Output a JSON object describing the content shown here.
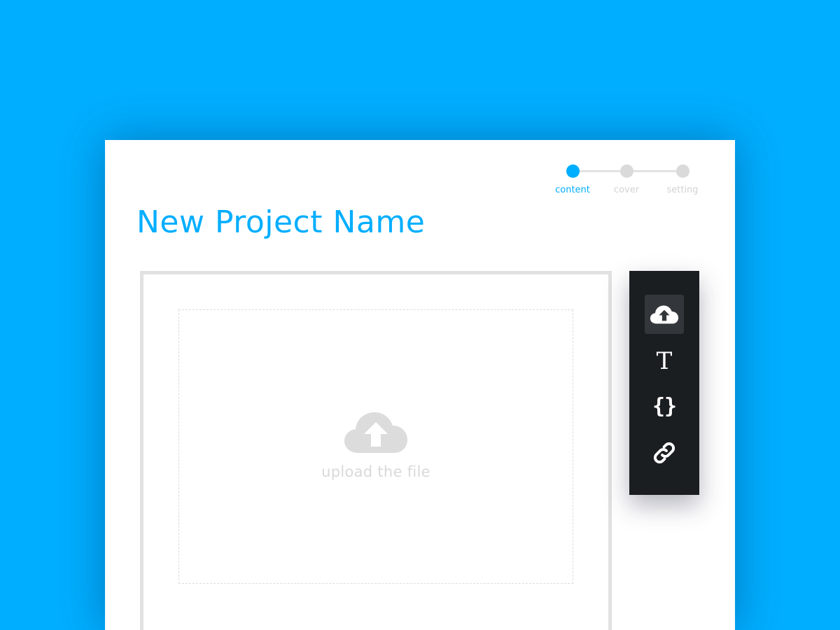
{
  "colors": {
    "background": "#00aeff",
    "accent": "#00aeff",
    "toolbar": "#1b1e21",
    "inactive": "#dadada"
  },
  "stepper": {
    "steps": [
      {
        "label": "content",
        "state": "active"
      },
      {
        "label": "cover",
        "state": "inactive"
      },
      {
        "label": "setting",
        "state": "inactive"
      }
    ]
  },
  "project": {
    "title": "New Project Name"
  },
  "upload": {
    "icon": "cloud-upload-icon",
    "label": "upload the file"
  },
  "toolbar": {
    "tools": [
      {
        "icon": "cloud-upload-icon",
        "active": true
      },
      {
        "icon": "text-icon",
        "glyph": "T",
        "active": false
      },
      {
        "icon": "code-icon",
        "glyph": "{}",
        "active": false
      },
      {
        "icon": "link-icon",
        "active": false
      }
    ]
  }
}
